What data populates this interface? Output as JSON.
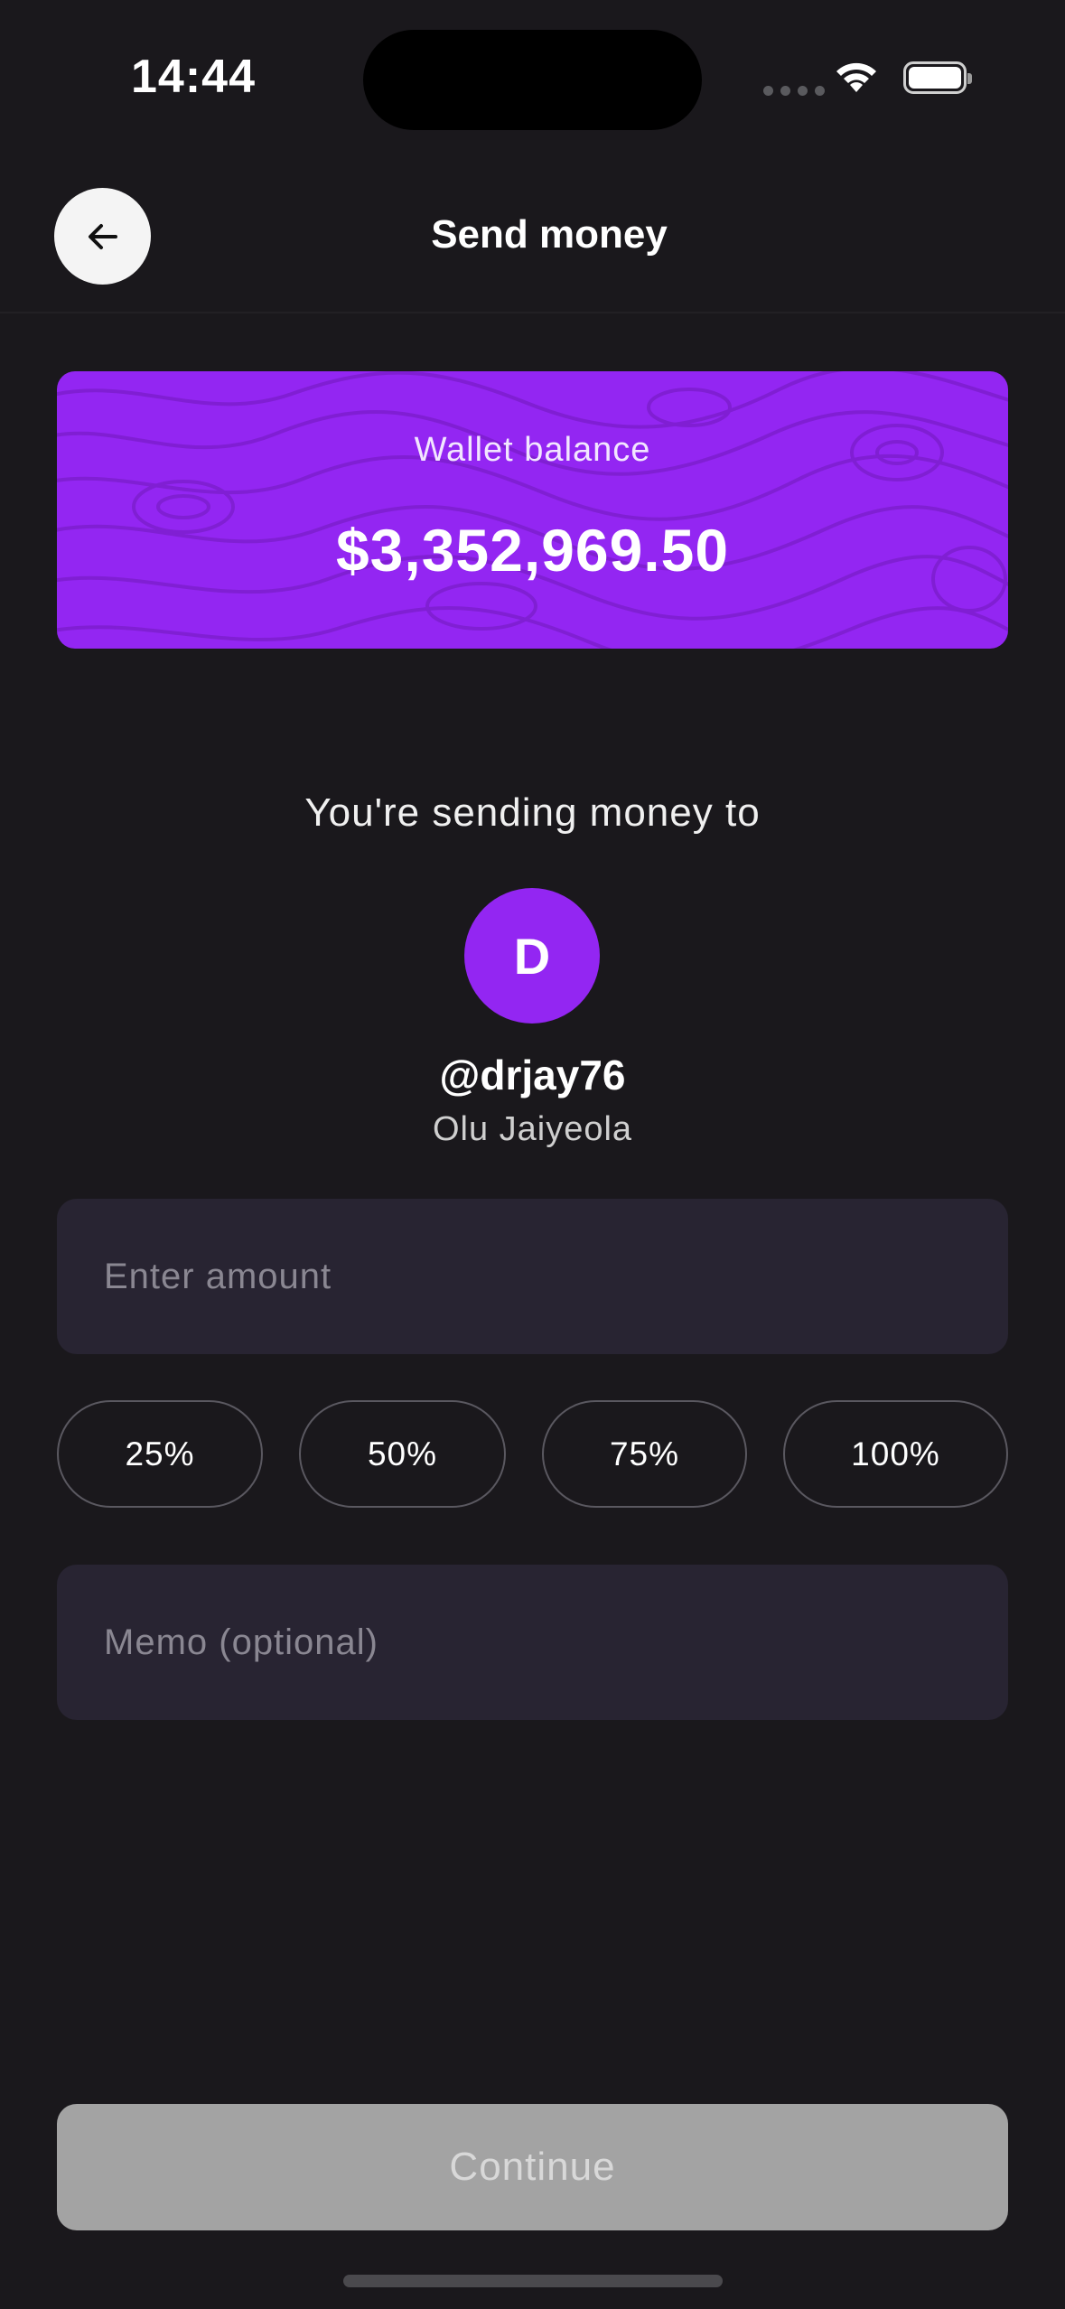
{
  "status_bar": {
    "time": "14:44"
  },
  "header": {
    "title": "Send money",
    "back_icon": "arrow-left-icon"
  },
  "wallet": {
    "label": "Wallet balance",
    "amount": "$3,352,969.50",
    "card_color": "#9326f2"
  },
  "recipient": {
    "intro": "You're sending money to",
    "avatar_initial": "D",
    "username": "@drjay76",
    "full_name": "Olu Jaiyeola"
  },
  "amount_input": {
    "placeholder": "Enter amount",
    "value": ""
  },
  "percent_options": [
    "25%",
    "50%",
    "75%",
    "100%"
  ],
  "memo_input": {
    "placeholder": "Memo (optional)",
    "value": ""
  },
  "continue_button": {
    "label": "Continue",
    "color": "#a3a3a3"
  },
  "colors": {
    "background": "#1a181c",
    "accent": "#9326f2",
    "input_background": "#282432"
  }
}
